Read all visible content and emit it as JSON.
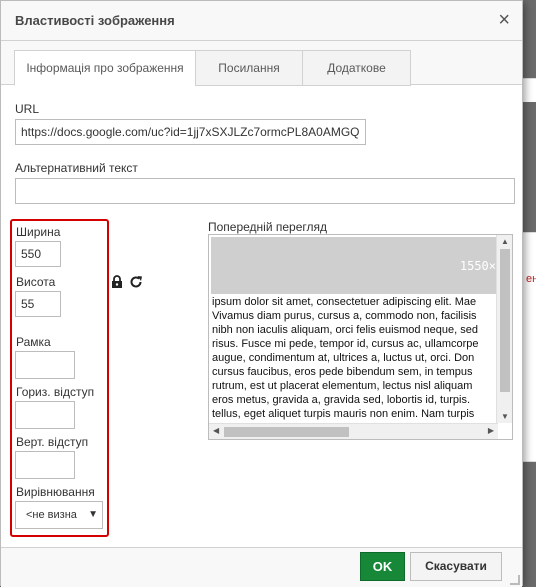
{
  "dialog": {
    "title": "Властивості зображення",
    "close_glyph": "×"
  },
  "tabs": [
    {
      "label": "Інформація про зображення",
      "active": true
    },
    {
      "label": "Посилання",
      "active": false
    },
    {
      "label": "Додаткове",
      "active": false
    }
  ],
  "form": {
    "url_label": "URL",
    "url_value": "https://docs.google.com/uc?id=1jj7xSXJLZc7ormcPL8A0AMGQ",
    "alt_label": "Альтернативний текст",
    "alt_value": "",
    "width_label": "Ширина",
    "width_value": "550",
    "height_label": "Висота",
    "height_value": "55",
    "border_label": "Рамка",
    "border_value": "",
    "hspace_label": "Гориз. відступ",
    "hspace_value": "",
    "vspace_label": "Верт. відступ",
    "vspace_value": "",
    "align_label": "Вирівнювання",
    "align_selected": "<не визна",
    "lock_icon": "lock-icon",
    "reset_icon": "reset-size-icon"
  },
  "preview": {
    "label": "Попередній перегляд",
    "image_size_text": "1550×",
    "lines": [
      "ipsum dolor sit amet, consectetuer adipiscing elit. Mae",
      "Vivamus diam purus, cursus a, commodo non, facilisis",
      "nibh non iaculis aliquam, orci felis euismod neque, sed",
      "risus. Fusce mi pede, tempor id, cursus ac, ullamcorpe",
      "augue, condimentum at, ultrices a, luctus ut, orci. Don",
      "cursus faucibus, eros pede bibendum sem, in tempus",
      "rutrum, est ut placerat elementum, lectus nisl aliquam",
      "eros metus, gravida a, gravida sed, lobortis id, turpis.",
      "tellus, eget aliquet turpis mauris non enim. Nam turpis"
    ]
  },
  "background": {
    "fragment_text": "ен"
  },
  "footer": {
    "ok_label": "OK",
    "cancel_label": "Скасувати"
  },
  "colors": {
    "ok_green": "#168838",
    "highlight_red": "#d40000"
  }
}
